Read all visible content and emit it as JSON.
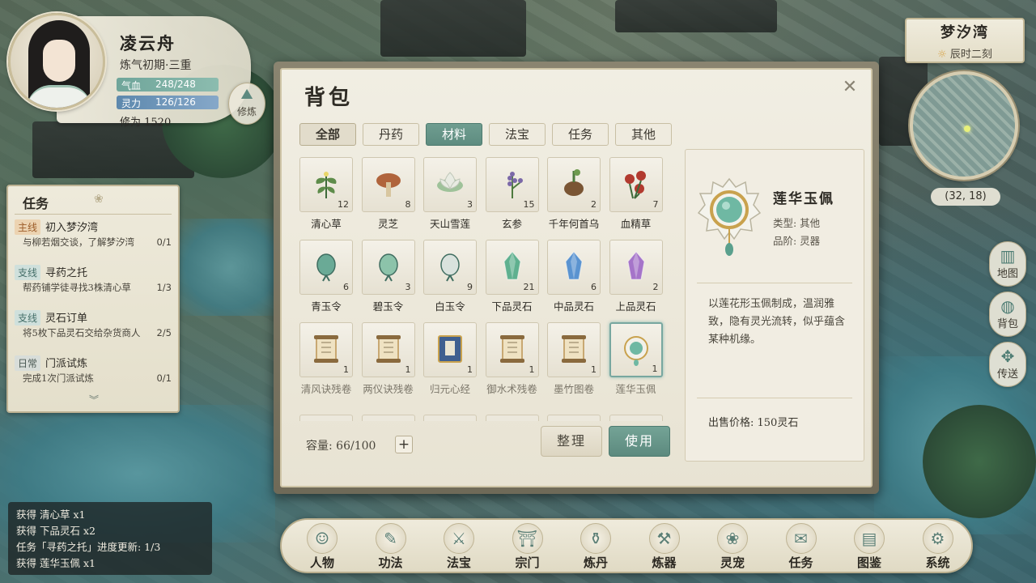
{
  "character": {
    "name": "凌云舟",
    "realm": "炼气初期·三重",
    "hp_label": "气血",
    "hp_value": "248/248",
    "hp_fraction": 1.0,
    "mp_label": "灵力",
    "mp_value": "126/126",
    "mp_fraction": 1.0,
    "cultivation": "修为 1520",
    "mirror_label": "修炼"
  },
  "quests": {
    "title": "任务",
    "items": [
      {
        "tag": "主线",
        "type": "main",
        "name": "初入梦汐湾",
        "desc": "与柳若烟交谈，了解梦汐湾",
        "progress": "0/1"
      },
      {
        "tag": "支线",
        "type": "side",
        "name": "寻药之托",
        "desc": "帮药铺学徒寻找3株清心草",
        "progress": "1/3"
      },
      {
        "tag": "支线",
        "type": "side",
        "name": "灵石订单",
        "desc": "将5枚下品灵石交给杂货商人",
        "progress": "2/5"
      },
      {
        "tag": "日常",
        "type": "daily",
        "name": "门派试炼",
        "desc": "完成1次门派试炼",
        "progress": "0/1"
      }
    ],
    "more_icon": "chevron-down-icon"
  },
  "location": {
    "name": "梦汐湾",
    "time": "辰时二刻",
    "coords": "(32, 18)"
  },
  "side_buttons": [
    {
      "label": "地图",
      "icon": "map-icon"
    },
    {
      "label": "背包",
      "icon": "bag-icon"
    },
    {
      "label": "传送",
      "icon": "teleport-icon"
    }
  ],
  "log": [
    "获得 清心草 x1",
    "获得 下品灵石 x2",
    "任务「寻药之托」进度更新: 1/3",
    "获得 莲华玉佩 x1"
  ],
  "nav": [
    {
      "label": "人物",
      "icon": "character-icon"
    },
    {
      "label": "功法",
      "icon": "technique-icon"
    },
    {
      "label": "法宝",
      "icon": "treasure-icon"
    },
    {
      "label": "宗门",
      "icon": "sect-icon"
    },
    {
      "label": "炼丹",
      "icon": "alchemy-icon"
    },
    {
      "label": "炼器",
      "icon": "forge-icon"
    },
    {
      "label": "灵宠",
      "icon": "pet-icon"
    },
    {
      "label": "任务",
      "icon": "quest-icon"
    },
    {
      "label": "图鉴",
      "icon": "codex-icon"
    },
    {
      "label": "系统",
      "icon": "system-icon"
    }
  ],
  "inventory": {
    "title": "背包",
    "close_icon": "close-icon",
    "tabs": [
      "全部",
      "丹药",
      "材料",
      "法宝",
      "任务",
      "其他"
    ],
    "active_tab": "材料",
    "items": [
      {
        "name": "清心草",
        "count": "12",
        "icon": "herb-icon",
        "color": "#5e8c4a"
      },
      {
        "name": "灵芝",
        "count": "8",
        "icon": "mushroom-icon",
        "color": "#b0643c"
      },
      {
        "name": "天山雪莲",
        "count": "3",
        "icon": "lotus-icon",
        "color": "#e8ebe2"
      },
      {
        "name": "玄参",
        "count": "15",
        "icon": "lavender-icon",
        "color": "#7b68a8"
      },
      {
        "name": "千年何首乌",
        "count": "2",
        "icon": "root-icon",
        "color": "#7a5534"
      },
      {
        "name": "血精草",
        "count": "7",
        "icon": "red-flower-icon",
        "color": "#b23a2f"
      },
      {
        "name": "青玉令",
        "count": "6",
        "icon": "jade-token-icon",
        "color": "#6aaa96"
      },
      {
        "name": "碧玉令",
        "count": "3",
        "icon": "jade-token-icon",
        "color": "#8cc3aa"
      },
      {
        "name": "白玉令",
        "count": "9",
        "icon": "white-jade-token-icon",
        "color": "#d9e2dd"
      },
      {
        "name": "下品灵石",
        "count": "21",
        "icon": "green-crystal-icon",
        "color": "#5fb08f"
      },
      {
        "name": "中品灵石",
        "count": "6",
        "icon": "blue-crystal-icon",
        "color": "#5a93d0"
      },
      {
        "name": "上品灵石",
        "count": "2",
        "icon": "purple-crystal-icon",
        "color": "#a574c9"
      },
      {
        "name": "清风诀残卷",
        "count": "1",
        "icon": "scroll-icon",
        "color": "#c8a872"
      },
      {
        "name": "两仪诀残卷",
        "count": "1",
        "icon": "scroll-icon",
        "color": "#c8a872"
      },
      {
        "name": "归元心经",
        "count": "1",
        "icon": "blue-book-icon",
        "color": "#3f5f8f"
      },
      {
        "name": "御水术残卷",
        "count": "1",
        "icon": "scroll-icon",
        "color": "#c8a872"
      },
      {
        "name": "墨竹图卷",
        "count": "1",
        "icon": "scroll-icon",
        "color": "#c8a872"
      },
      {
        "name": "莲华玉佩",
        "count": "1",
        "icon": "jade-pendant-icon",
        "color": "#6fb8a3"
      }
    ],
    "capacity": "容量: 66/100",
    "sort_label": "整理",
    "use_label": "使用",
    "detail": {
      "name": "莲华玉佩",
      "type": "类型: 其他",
      "grade": "品阶: 灵器",
      "desc": "以莲花形玉佩制成，温润雅致，隐有灵光流转，似乎蕴含某种机缘。",
      "price": "出售价格: 150灵石"
    }
  }
}
